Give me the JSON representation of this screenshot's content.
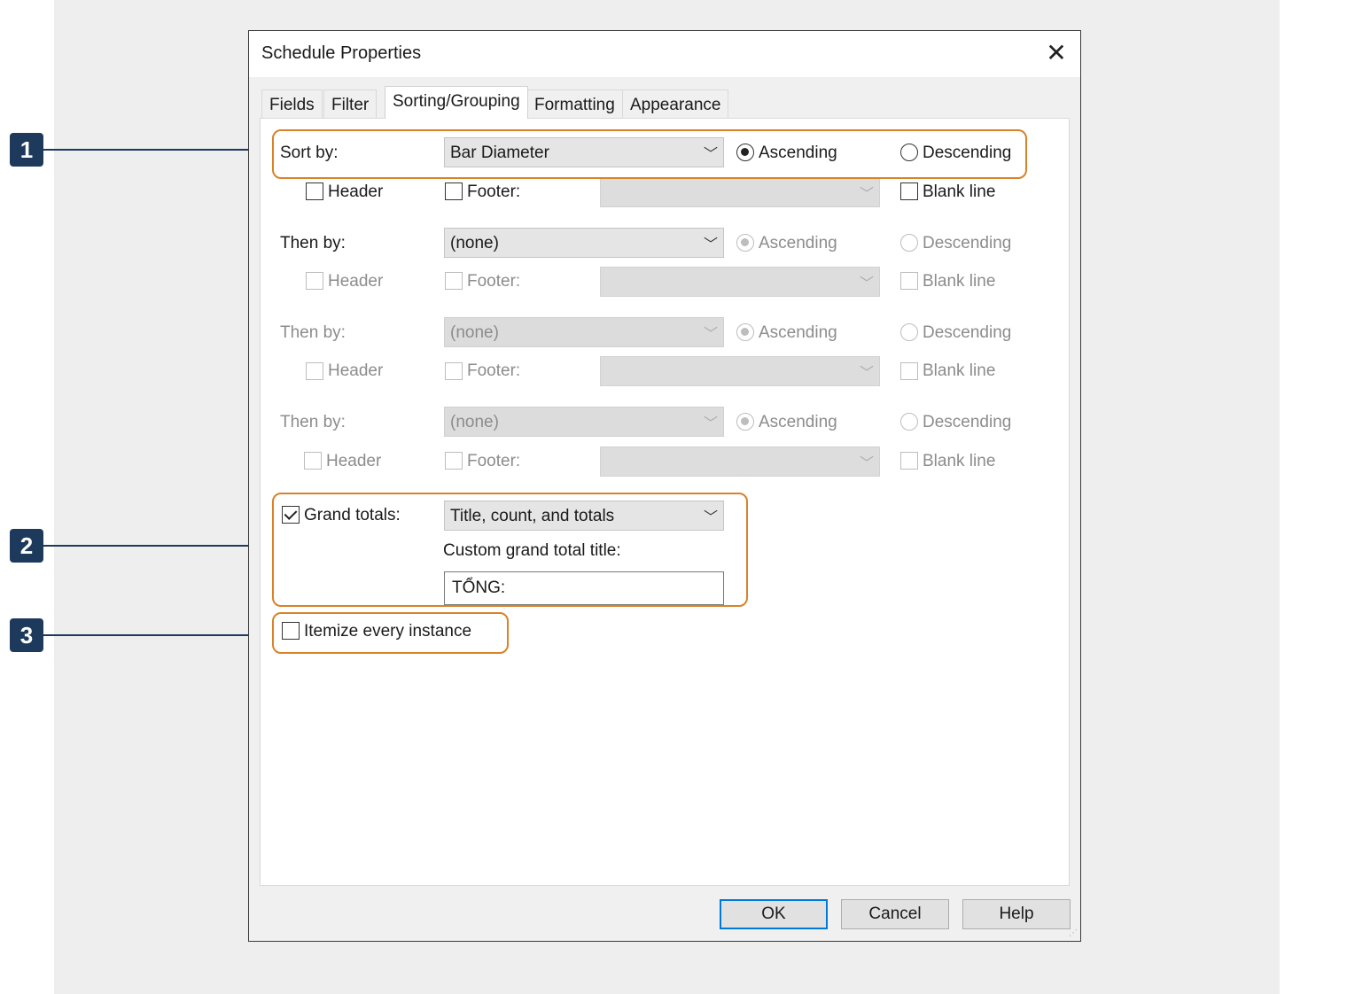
{
  "dialog": {
    "title": "Schedule Properties",
    "close_glyph": "✕"
  },
  "tabs": [
    {
      "label": "Fields"
    },
    {
      "label": "Filter"
    },
    {
      "label": "Sorting/Grouping",
      "active": true
    },
    {
      "label": "Formatting"
    },
    {
      "label": "Appearance"
    }
  ],
  "sort_groups": [
    {
      "label": "Sort by:",
      "value": "Bar Diameter",
      "ascending": "Ascending",
      "descending": "Descending",
      "header": "Header",
      "footer": "Footer:",
      "blank_line": "Blank line"
    },
    {
      "label": "Then by:",
      "value": "(none)",
      "ascending": "Ascending",
      "descending": "Descending",
      "header": "Header",
      "footer": "Footer:",
      "blank_line": "Blank line"
    },
    {
      "label": "Then by:",
      "value": "(none)",
      "ascending": "Ascending",
      "descending": "Descending",
      "header": "Header",
      "footer": "Footer:",
      "blank_line": "Blank line"
    },
    {
      "label": "Then by:",
      "value": "(none)",
      "ascending": "Ascending",
      "descending": "Descending",
      "header": "Header",
      "footer": "Footer:",
      "blank_line": "Blank line"
    }
  ],
  "grand_totals": {
    "label": "Grand totals:",
    "checked": true,
    "value": "Title, count, and totals",
    "custom_title_label": "Custom grand total title:",
    "custom_title_value": "TỔNG:"
  },
  "itemize": {
    "label": "Itemize every instance",
    "checked": false
  },
  "buttons": {
    "ok": "OK",
    "cancel": "Cancel",
    "help": "Help"
  },
  "callouts": [
    "1",
    "2",
    "3"
  ],
  "colors": {
    "highlight": "#d9822b",
    "callout": "#1d3a5c",
    "default_button_border": "#0078d7"
  }
}
